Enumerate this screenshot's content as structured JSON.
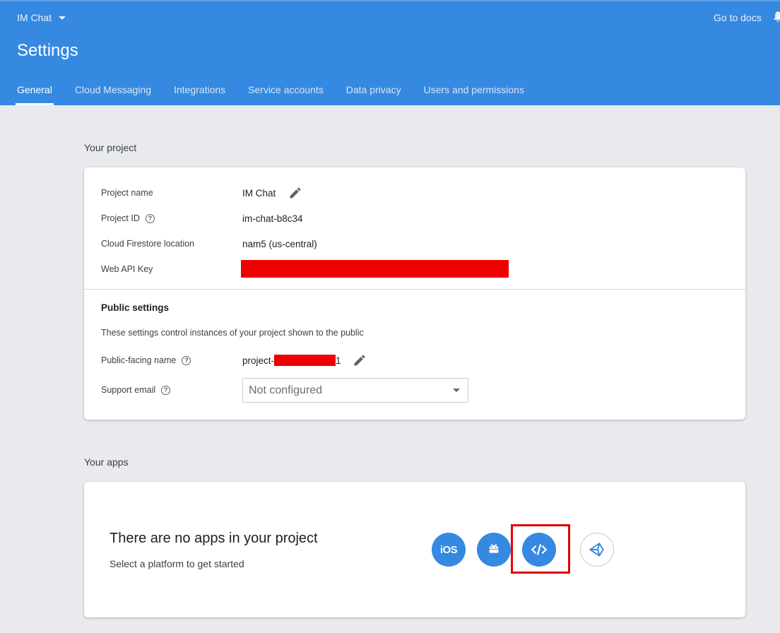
{
  "header": {
    "project_name": "IM Chat",
    "docs_link": "Go to docs",
    "page_title": "Settings",
    "tabs": [
      {
        "label": "General",
        "active": true
      },
      {
        "label": "Cloud Messaging"
      },
      {
        "label": "Integrations"
      },
      {
        "label": "Service accounts"
      },
      {
        "label": "Data privacy"
      },
      {
        "label": "Users and permissions"
      }
    ],
    "accent_color": "#3589e1"
  },
  "your_project": {
    "section_title": "Your project",
    "rows": {
      "project_name": {
        "label": "Project name",
        "value": "IM Chat"
      },
      "project_id": {
        "label": "Project ID",
        "value": "im-chat-b8c34"
      },
      "firestore_location": {
        "label": "Cloud Firestore location",
        "value": "nam5 (us-central)"
      },
      "web_api_key": {
        "label": "Web API Key",
        "value": ""
      }
    },
    "public_settings": {
      "heading": "Public settings",
      "description": "These settings control instances of your project shown to the public",
      "public_facing_name": {
        "label": "Public-facing name",
        "prefix": "project-",
        "suffix": "1"
      },
      "support_email": {
        "label": "Support email",
        "selected": "Not configured"
      }
    },
    "redaction_color": "#ee0000"
  },
  "your_apps": {
    "section_title": "Your apps",
    "empty_title": "There are no apps in your project",
    "empty_subtitle": "Select a platform to get started",
    "platforms": [
      {
        "name": "ios",
        "label": "iOS",
        "icon": "ios-icon"
      },
      {
        "name": "android",
        "icon": "android-icon"
      },
      {
        "name": "web",
        "icon": "code-icon",
        "highlighted": true
      },
      {
        "name": "unity",
        "icon": "unity-icon"
      }
    ],
    "highlight_color": "#e00000"
  }
}
